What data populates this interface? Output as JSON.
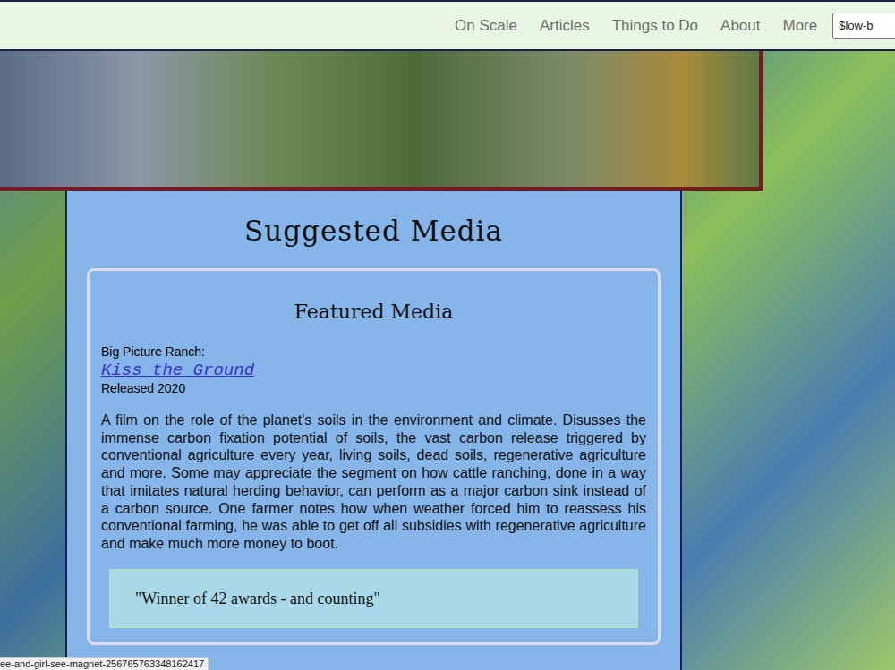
{
  "nav": {
    "items": [
      "On Scale",
      "Articles",
      "Things to Do",
      "About",
      "More"
    ],
    "search": {
      "value": "$low-b"
    }
  },
  "page": {
    "title": "Suggested Media"
  },
  "featured": {
    "heading": "Featured Media",
    "producer": "Big Picture Ranch:",
    "title": "Kiss the Ground",
    "released": "Released 2020",
    "description": "A film on the role of the planet's soils in the environment and climate. Disusses the immense carbon fixation potential of soils, the vast carbon release triggered by conventional agriculture every year, living soils, dead soils, regenerative agriculture and more. Some may appreciate the segment on how cattle ranching, done in a way that imitates natural herding behavior, can perform as a major carbon sink instead of a carbon source. One farmer notes how when weather forced him to reassess his conventional farming, he was able to get off all subsidies with regenerative agriculture and make much more money to boot.",
    "quote": "\"Winner of 42 awards - and counting\""
  },
  "status_bar": {
    "text": "ee-and-girl-see-magnet-256765763348162417"
  }
}
